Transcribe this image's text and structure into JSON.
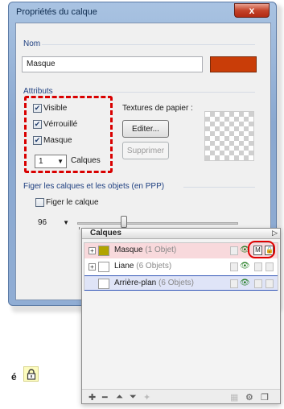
{
  "dialog": {
    "title": "Propriétés du calque",
    "close_label": "x",
    "name_group": "Nom",
    "name_value": "Masque",
    "layer_color": "#c93d08",
    "attributes_group": "Attributs",
    "checkboxes": [
      {
        "label": "Visible",
        "checked": true
      },
      {
        "label": "Vérrouillé",
        "checked": true
      },
      {
        "label": "Masque",
        "checked": true
      }
    ],
    "layer_count_value": "1",
    "layer_count_label": "Calques",
    "paper_textures_label": "Textures de papier :",
    "edit_button": "Editer...",
    "delete_button": "Supprimer",
    "pin_group": "Figer les calques et les objets (en PPP)",
    "pin_checkbox": "Figer le calque",
    "ppp_value": "96"
  },
  "panel": {
    "title": "Calques",
    "layers": [
      {
        "name": "Masque",
        "count": "(1 Objet)",
        "thumb_color": "#b2a400",
        "row_color": "#f8d9dc"
      },
      {
        "name": "Liane",
        "count": "(6 Objets)",
        "thumb_color": "#ffffff",
        "row_color": "#ffffff"
      },
      {
        "name": "Arrière-plan",
        "count": "(6 Objets)",
        "thumb_color": "#ffffff",
        "row_color": "#dfe4f7"
      }
    ],
    "mask_icon_letter": "M"
  },
  "side_note": {
    "text": "é"
  }
}
